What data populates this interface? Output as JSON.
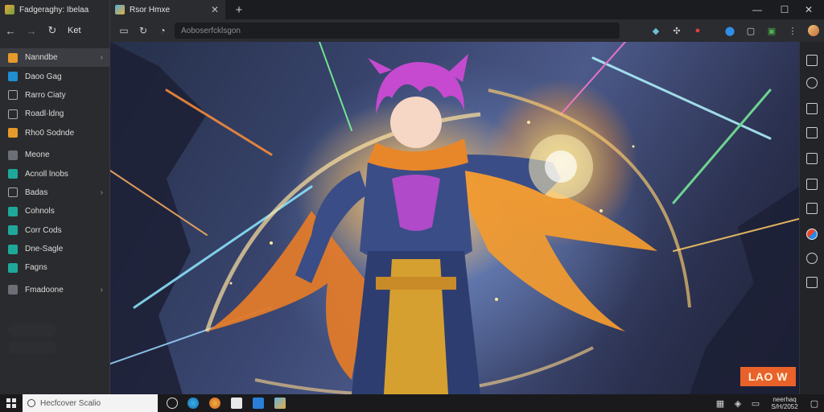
{
  "app": {
    "title": "Fadgeraghy: Ibelaa",
    "nav_label": "Ket"
  },
  "icons": {
    "back": "←",
    "forward": "→",
    "refresh": "↻"
  },
  "sidebar": {
    "items": [
      {
        "label": "Nanndbe",
        "icon": "orange",
        "chevron": "›",
        "active": true
      },
      {
        "label": "Daoo Gag",
        "icon": "blue",
        "chevron": ""
      },
      {
        "label": "Rarro Ciaty",
        "icon": "outline",
        "chevron": ""
      },
      {
        "label": "Roadl·ldng",
        "icon": "outline",
        "chevron": ""
      },
      {
        "label": "Rho0 Sodnde",
        "icon": "orange",
        "chevron": ""
      },
      {
        "label": "Meone",
        "icon": "gray",
        "chevron": ""
      },
      {
        "label": "Acnoll lnobs",
        "icon": "teal",
        "chevron": ""
      },
      {
        "label": "Badas",
        "icon": "outline",
        "chevron": "›"
      },
      {
        "label": "Cohnols",
        "icon": "teal",
        "chevron": ""
      },
      {
        "label": "Corr Cods",
        "icon": "teal",
        "chevron": ""
      },
      {
        "label": "Dne-Sagle",
        "icon": "teal",
        "chevron": ""
      },
      {
        "label": "Fagns",
        "icon": "teal",
        "chevron": ""
      },
      {
        "label": "Fmadoone",
        "icon": "gray",
        "chevron": "›"
      }
    ]
  },
  "tab": {
    "title": "Rsor Hmxe",
    "close": "✕",
    "new_tab": "+"
  },
  "window": {
    "minimize": "—",
    "maximize": "☐",
    "close": "✕"
  },
  "toolbar": {
    "address_text": "Aoboserfcklsgon"
  },
  "banner": {
    "text": "LAO W"
  },
  "taskbar": {
    "search_text": "Hecfcover Scalio",
    "clock_line1": "neerhaq",
    "clock_line2": "S/H/2052"
  },
  "colors": {
    "accent": "#e8622a",
    "panel": "#2a2b2e",
    "chrome": "#1b1c1f"
  }
}
